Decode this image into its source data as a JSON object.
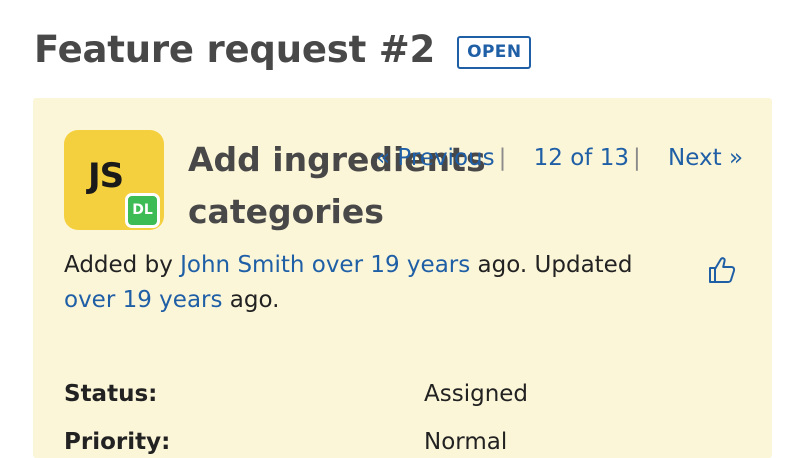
{
  "header": {
    "title": "Feature request #2",
    "status_badge": "OPEN"
  },
  "issue": {
    "avatar": {
      "logo_text": "JS",
      "badge_text": "DL",
      "colors": {
        "logo_bg": "#f5d03e",
        "badge_bg": "#3dbb55"
      }
    },
    "subject": "Add ingredients categories",
    "pager": {
      "previous_label": "« Previous",
      "separator": "|",
      "position_label": "12 of 13",
      "next_label": "Next »"
    },
    "author": {
      "prefix": "Added by ",
      "author_name": "John Smith",
      "space": " ",
      "created_ago": "over 19 years",
      "middle": " ago. Updated ",
      "updated_ago": "over 19 years",
      "suffix": " ago."
    },
    "like_icon": "thumbs-up-icon",
    "attributes": [
      {
        "label": "Status:",
        "value": "Assigned"
      },
      {
        "label": "Priority:",
        "value": "Normal"
      }
    ]
  },
  "colors": {
    "link": "#1f5fa6",
    "panel_bg": "#fcf6d9",
    "title": "#484848"
  }
}
